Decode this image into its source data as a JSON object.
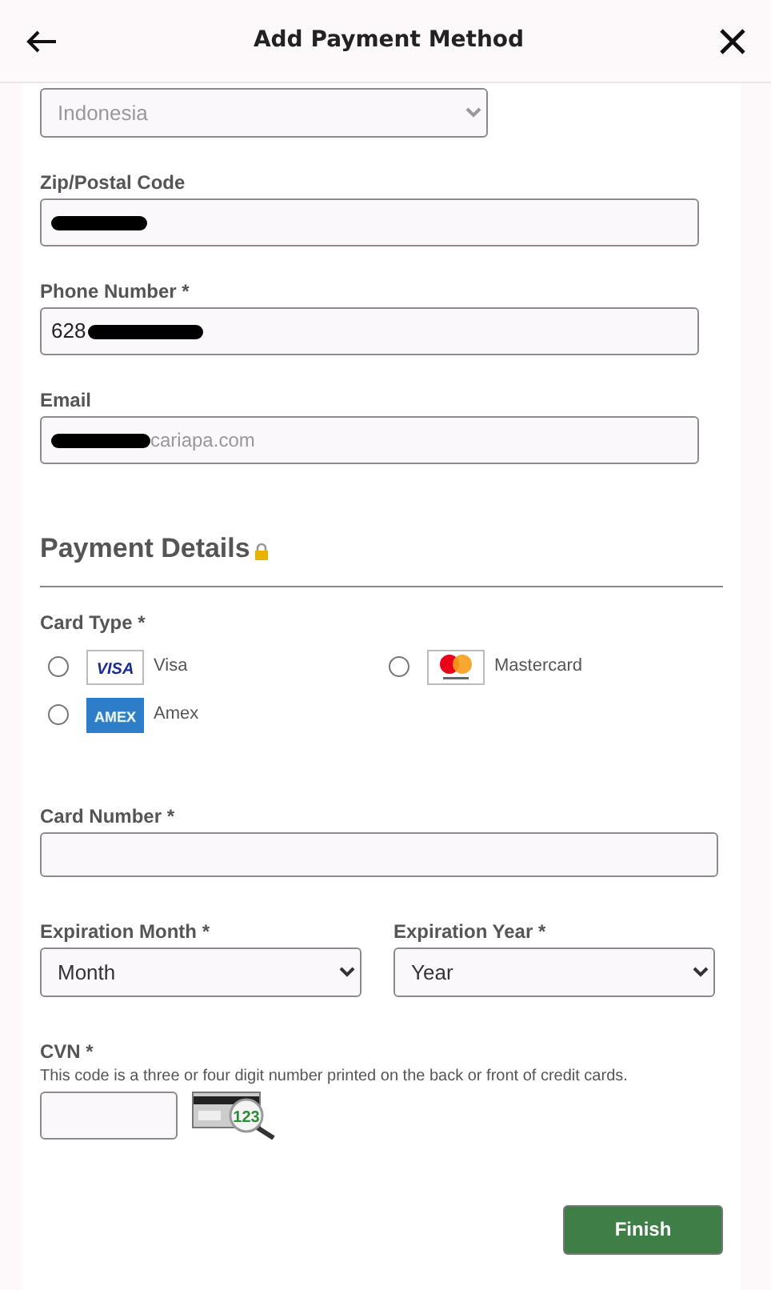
{
  "header": {
    "title": "Add Payment Method"
  },
  "country": {
    "value": "Indonesia",
    "disabled": true
  },
  "contact_fields": [
    {
      "label": "Zip/Postal Code",
      "redacted": true
    },
    {
      "label": "Phone Number *",
      "value": "628",
      "redacted": true
    },
    {
      "label": "Email",
      "placeholder": "cariapa.com",
      "redacted": true
    }
  ],
  "payment_details": {
    "title": "Payment Details",
    "card_type": {
      "label": "Card Type *",
      "options": [
        {
          "kind": "visa",
          "label": "Visa",
          "logo_text": "VISA",
          "selected": false
        },
        {
          "kind": "mastercard",
          "label": "Mastercard",
          "selected": false
        },
        {
          "kind": "amex",
          "label": "Amex",
          "logo_text": "AMEX",
          "selected": false
        }
      ]
    },
    "card_number": {
      "label": "Card Number *"
    },
    "expiration_month": {
      "label": "Expiration Month *",
      "value": "Month"
    },
    "expiration_year": {
      "label": "Expiration Year *",
      "value": "Year"
    },
    "cvn": {
      "label": "CVN *",
      "help": "This code is a three or four digit number printed on the back or front of credit cards.",
      "image_text": "123"
    }
  },
  "buttons": [
    {
      "label": "Finish"
    }
  ]
}
